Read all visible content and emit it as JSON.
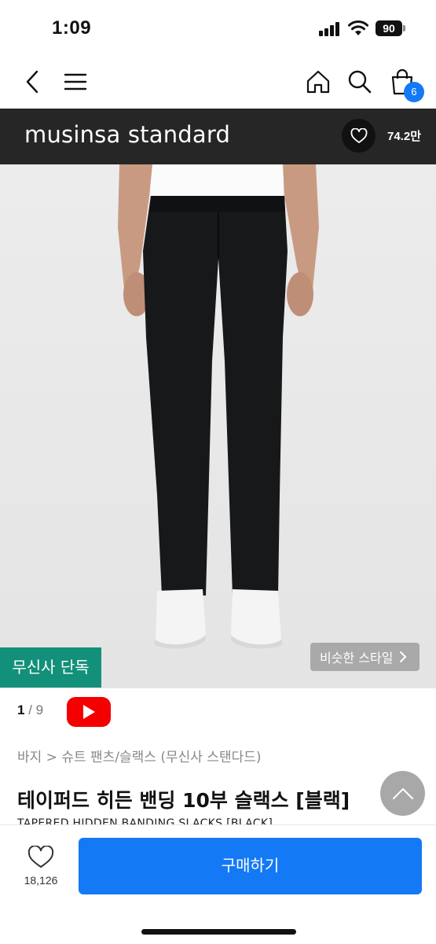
{
  "status_bar": {
    "time": "1:09",
    "battery": "90"
  },
  "nav": {
    "cart_count": "6"
  },
  "brand": {
    "name": "musinsa standard",
    "like_count": "74.2만"
  },
  "product_image": {
    "exclusive_badge": "무신사 단독",
    "similar_style_label": "비슷한 스타일"
  },
  "pager": {
    "current": "1",
    "separator": "/",
    "total": "9"
  },
  "breadcrumb": "바지 > 슈트 팬츠/슬랙스 (무신사 스탠다드)",
  "product": {
    "title": "테이퍼드 히든 밴딩 10부 슬랙스 [블랙]",
    "subtitle": "TAPERED HIDDEN BANDING SLACKS [BLACK]"
  },
  "bottom_bar": {
    "like_count": "18,126",
    "buy_label": "구매하기"
  },
  "colors": {
    "accent": "#1479f5",
    "brand_bar": "#262626",
    "exclusive_badge": "#139079",
    "youtube": "#f40000"
  },
  "icons": [
    "back-icon",
    "menu-icon",
    "home-icon",
    "search-icon",
    "cart-icon",
    "heart-icon",
    "youtube-icon",
    "chevron-up-icon",
    "chevron-right-icon"
  ]
}
